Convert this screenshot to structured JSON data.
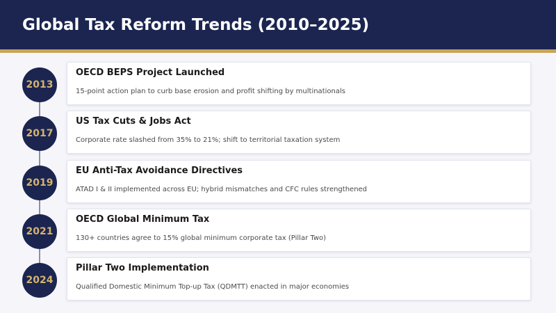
{
  "header": {
    "title": "Global Tax Reform Trends (2010–2025)"
  },
  "colors": {
    "header_bg": "#1b2550",
    "accent_gold": "#c9a55a",
    "circle_bg": "#1b2550",
    "year_text": "#d4b370"
  },
  "events": [
    {
      "year": "2013",
      "title": "OECD BEPS Project Launched",
      "description": "15-point action plan to curb base erosion and profit shifting by multinationals"
    },
    {
      "year": "2017",
      "title": "US Tax Cuts & Jobs Act",
      "description": "Corporate rate slashed from 35% to 21%; shift to territorial taxation system"
    },
    {
      "year": "2019",
      "title": "EU Anti-Tax Avoidance Directives",
      "description": "ATAD I & II implemented across EU; hybrid mismatches and CFC rules strengthened"
    },
    {
      "year": "2021",
      "title": "OECD Global Minimum Tax",
      "description": "130+ countries agree to 15% global minimum corporate tax (Pillar Two)"
    },
    {
      "year": "2024",
      "title": "Pillar Two Implementation",
      "description": "Qualified Domestic Minimum Top-up Tax (QDMTT) enacted in major economies"
    }
  ]
}
